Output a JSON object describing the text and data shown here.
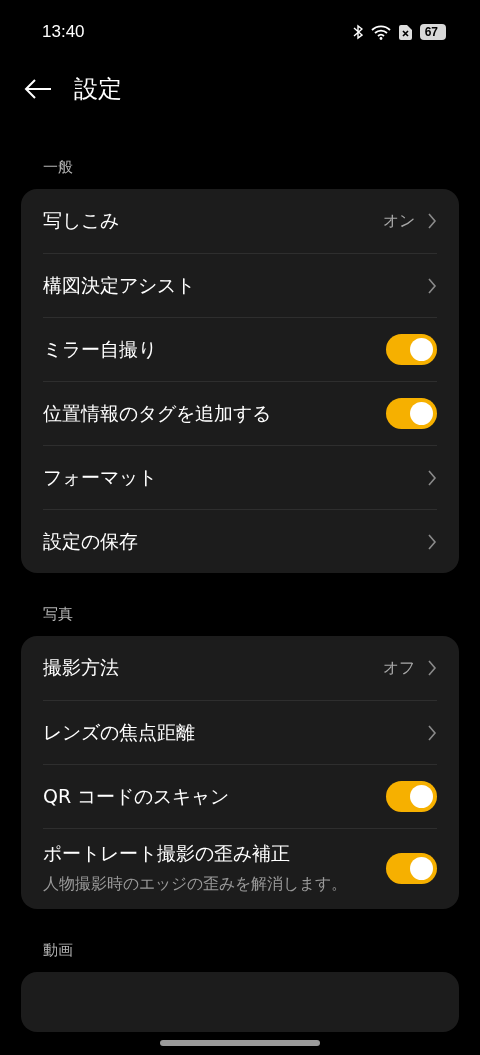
{
  "status_bar": {
    "time": "13:40",
    "battery": "67"
  },
  "header": {
    "title": "設定"
  },
  "sections": [
    {
      "title": "一般",
      "rows": [
        {
          "kind": "link",
          "label": "写しこみ",
          "value": "オン"
        },
        {
          "kind": "link",
          "label": "構図決定アシスト"
        },
        {
          "kind": "toggle",
          "label": "ミラー自撮り",
          "on": true
        },
        {
          "kind": "toggle",
          "label": "位置情報のタグを追加する",
          "on": true
        },
        {
          "kind": "link",
          "label": "フォーマット"
        },
        {
          "kind": "link",
          "label": "設定の保存"
        }
      ]
    },
    {
      "title": "写真",
      "rows": [
        {
          "kind": "link",
          "label": "撮影方法",
          "value": "オフ"
        },
        {
          "kind": "link",
          "label": "レンズの焦点距離"
        },
        {
          "kind": "toggle",
          "label": "QR コードのスキャン",
          "on": true
        },
        {
          "kind": "toggle",
          "label": "ポートレート撮影の歪み補正",
          "description": "人物撮影時のエッジの歪みを解消します。",
          "on": true
        }
      ]
    },
    {
      "title": "動画"
    }
  ]
}
